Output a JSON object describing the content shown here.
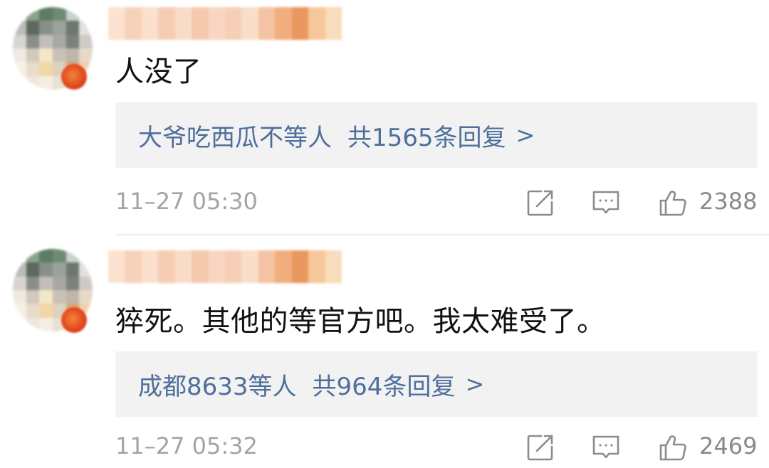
{
  "comments": [
    {
      "text": "人没了",
      "reply_users": "大爷吃西瓜不等人",
      "reply_count": "共1565条回复",
      "reply_chevron": ">",
      "timestamp": "11–27 05:30",
      "likes": "2388"
    },
    {
      "text": "猝死。其他的等官方吧。我太难受了。",
      "reply_users": "成都8633等人",
      "reply_count": "共964条回复",
      "reply_chevron": ">",
      "timestamp": "11–27 05:32",
      "likes": "2469"
    }
  ],
  "icons": {
    "share": "share-icon",
    "comment": "comment-icon",
    "like": "thumbs-up-icon"
  },
  "colors": {
    "reply_link": "#4e6f9c",
    "reply_background": "#f2f2f2",
    "meta_text": "#a4a4a4",
    "icon_stroke": "#8c8c8c",
    "vip_badge": "#e2481c"
  }
}
